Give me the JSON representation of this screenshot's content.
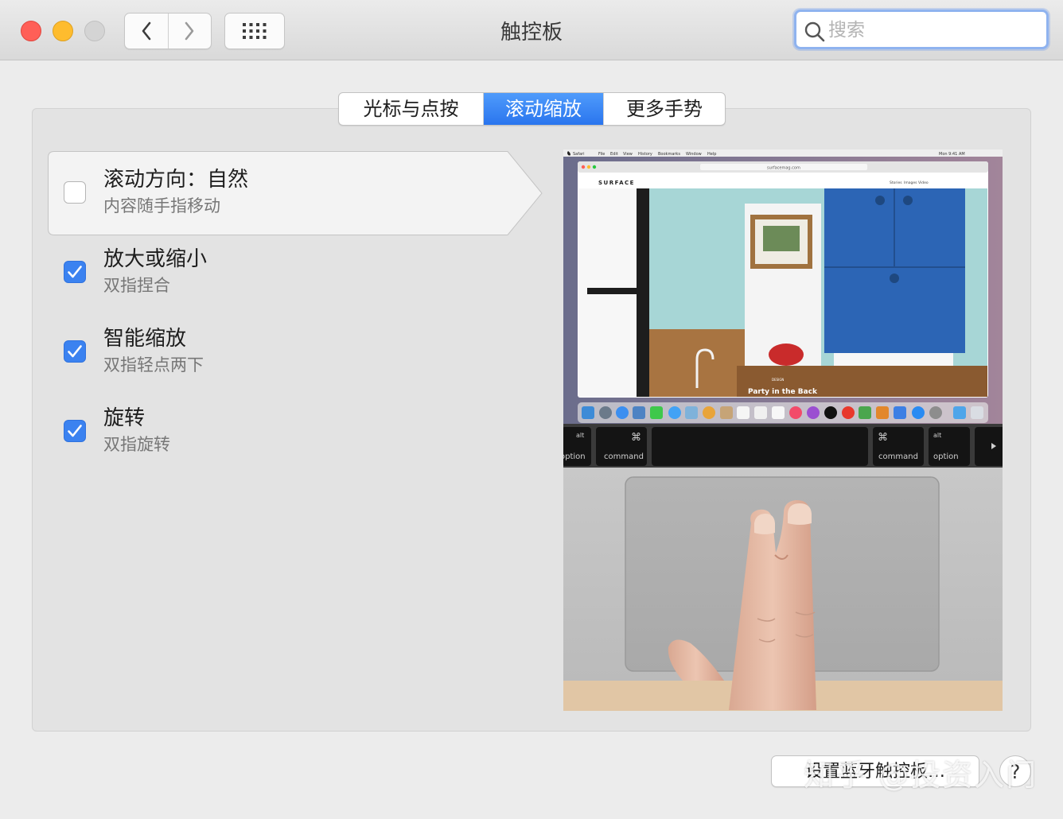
{
  "window": {
    "title": "触控板",
    "search_placeholder": "搜索"
  },
  "tabs": [
    {
      "label": "光标与点按",
      "selected": false
    },
    {
      "label": "滚动缩放",
      "selected": true
    },
    {
      "label": "更多手势",
      "selected": false
    }
  ],
  "options": [
    {
      "title": "滚动方向：自然",
      "subtitle": "内容随手指移动",
      "checked": false,
      "selected": true
    },
    {
      "title": "放大或缩小",
      "subtitle": "双指捏合",
      "checked": true,
      "selected": false
    },
    {
      "title": "智能缩放",
      "subtitle": "双指轻点两下",
      "checked": true,
      "selected": false
    },
    {
      "title": "旋转",
      "subtitle": "双指旋转",
      "checked": true,
      "selected": false
    }
  ],
  "preview": {
    "menubar_app": "Safari",
    "menubar_items": [
      "File",
      "Edit",
      "View",
      "History",
      "Bookmarks",
      "Window",
      "Help"
    ],
    "clock": "Mon 9:41 AM",
    "url": "surfacemag.com",
    "site_logo": "SURFACE",
    "site_nav": [
      "Stories",
      "Images",
      "Video"
    ],
    "caption_small": "DESIGN",
    "caption": "Party in the Back",
    "keys": [
      {
        "top": "alt",
        "bottom": "option"
      },
      {
        "top": "⌘",
        "bottom": "command"
      },
      {
        "top": "⌘",
        "bottom": "command"
      },
      {
        "top": "alt",
        "bottom": "option"
      }
    ]
  },
  "bottom": {
    "bluetooth_button": "设置蓝牙触控板…",
    "help_button": "?"
  },
  "watermark": "知乎 @投资入门",
  "colors": {
    "accent": "#3b82f0",
    "tab_selected": "#2a75ee",
    "close": "#ff5f57",
    "minimize": "#febc2e"
  }
}
